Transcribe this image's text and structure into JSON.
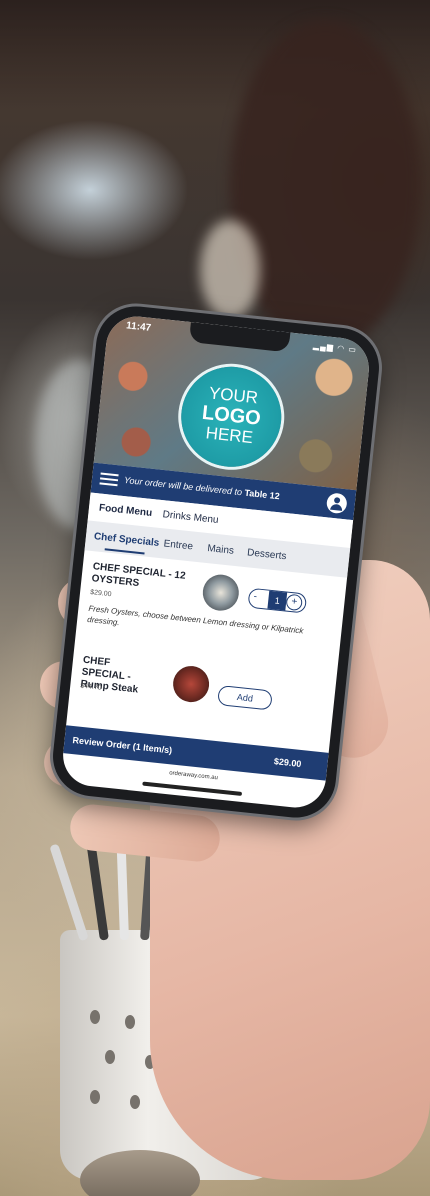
{
  "status_bar": {
    "time": "11:47",
    "icons": "▂▄▆ ◠ ▭"
  },
  "hero": {
    "logo_line1": "YOUR",
    "logo_line2": "LOGO",
    "logo_line3": "HERE"
  },
  "delivery": {
    "text": "Your order will be delivered to",
    "table": "Table 12"
  },
  "menu_tabs": [
    {
      "label": "Food Menu"
    },
    {
      "label": "Drinks Menu"
    }
  ],
  "category_tabs": [
    {
      "label": "Chef Specials"
    },
    {
      "label": "Entree"
    },
    {
      "label": "Mains"
    },
    {
      "label": "Desserts"
    }
  ],
  "items": [
    {
      "title": "CHEF SPECIAL - 12 OYSTERS",
      "price": "$29.00",
      "description": "Fresh Oysters, choose between Lemon dressing or Kilpatrick dressing.",
      "quantity": "1",
      "minus": "-",
      "plus": "+"
    },
    {
      "title": "CHEF SPECIAL - Rump Steak",
      "price": "$44.70",
      "add_label": "Add"
    }
  ],
  "review": {
    "label": "Review Order (1 Item/s)",
    "total": "$29.00"
  },
  "footer": {
    "url": "orderaway.com.au"
  },
  "colors": {
    "brand": "#1f3d73",
    "logo": "#1e9ca6"
  }
}
